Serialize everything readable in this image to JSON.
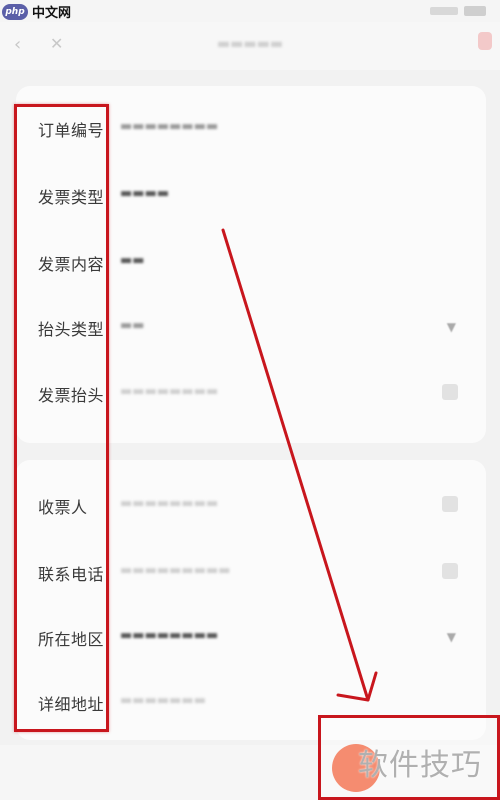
{
  "status_bar": {
    "site_logo_mark": "php",
    "site_logo_text": "中文网"
  },
  "form": {
    "invoice_section": [
      {
        "label": "订单编号",
        "control": "none"
      },
      {
        "label": "发票类型",
        "control": "none"
      },
      {
        "label": "发票内容",
        "control": "none"
      },
      {
        "label": "抬头类型",
        "control": "chevron"
      },
      {
        "label": "发票抬头",
        "control": "square"
      }
    ],
    "recipient_section": [
      {
        "label": "收票人",
        "control": "square"
      },
      {
        "label": "联系电话",
        "control": "square"
      },
      {
        "label": "所在地区",
        "control": "chevron"
      },
      {
        "label": "详细地址",
        "control": "none"
      }
    ]
  },
  "watermark": "软件技巧",
  "colors": {
    "annotation_red": "#c8161d",
    "accent_orange": "#ee4011"
  }
}
